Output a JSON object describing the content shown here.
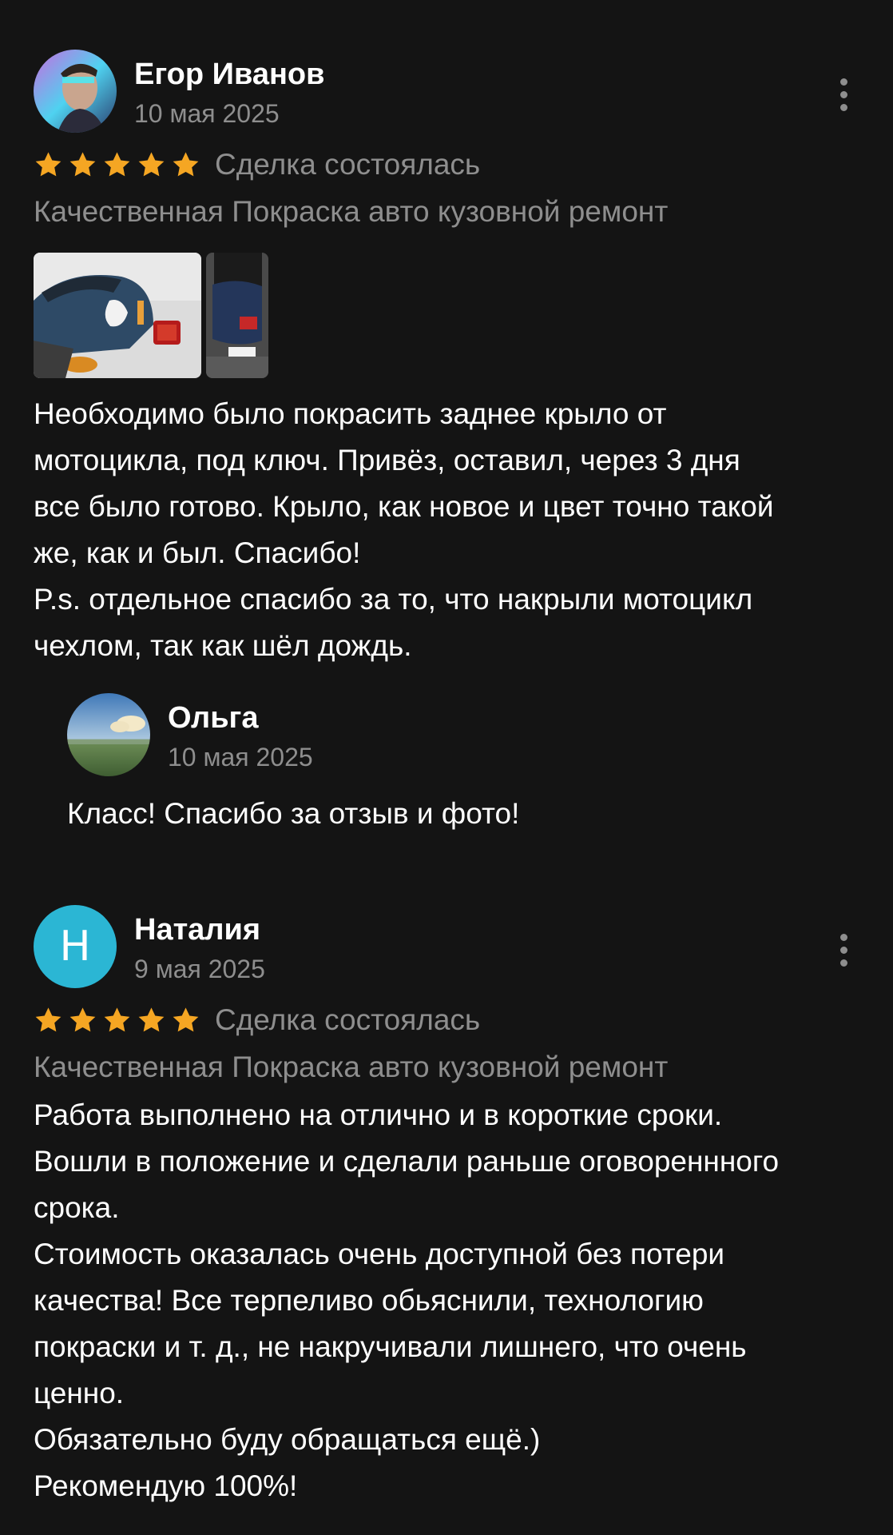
{
  "reviews": [
    {
      "author": "Егор Иванов",
      "date": "10 мая 2025",
      "rating": 5,
      "deal_status": "Сделка состоялась",
      "service": "Качественная Покраска авто кузовной ремонт",
      "photos": [
        "motorcycle-rear-fender-photo",
        "motorcycle-license-plate-photo"
      ],
      "text_lines": [
        "Необходимо было покрасить заднее крыло от",
        "мотоцикла, под ключ. Привёз, оставил, через 3 дня",
        "все было готово. Крыло, как новое и цвет точно такой",
        "же, как и был. Спасибо!",
        "P.s. отдельное спасибо за то, что накрыли мотоцикл",
        "чехлом, так как шёл дождь."
      ],
      "reply": {
        "author": "Ольга",
        "date": "10 мая 2025",
        "text": "Класс! Спасибо за отзыв и фото!"
      }
    },
    {
      "author": "Наталия",
      "avatar_initial": "Н",
      "avatar_color": "#2bb6d4",
      "date": "9 мая 2025",
      "rating": 5,
      "deal_status": "Сделка состоялась",
      "service": "Качественная Покраска авто кузовной ремонт",
      "text_lines": [
        "Работа выполнено на отлично и в короткие сроки.",
        "Вошли в положение и сделали раньше оговореннного",
        "срока.",
        "Стоимость оказалась очень доступной без потери",
        "качества! Все терпеливо обьяснили, технологию",
        "покраски и т. д., не накручивали лишнего, что очень",
        "ценно.",
        "Обязательно буду обращаться ещё.)",
        "Рекомендую 100%!"
      ]
    }
  ],
  "colors": {
    "background": "#141414",
    "star": "#f5a623",
    "secondary_text": "#8e8e8e",
    "primary_text": "#ffffff"
  },
  "icons": {
    "star": "star-icon",
    "more": "more-vertical-icon"
  }
}
